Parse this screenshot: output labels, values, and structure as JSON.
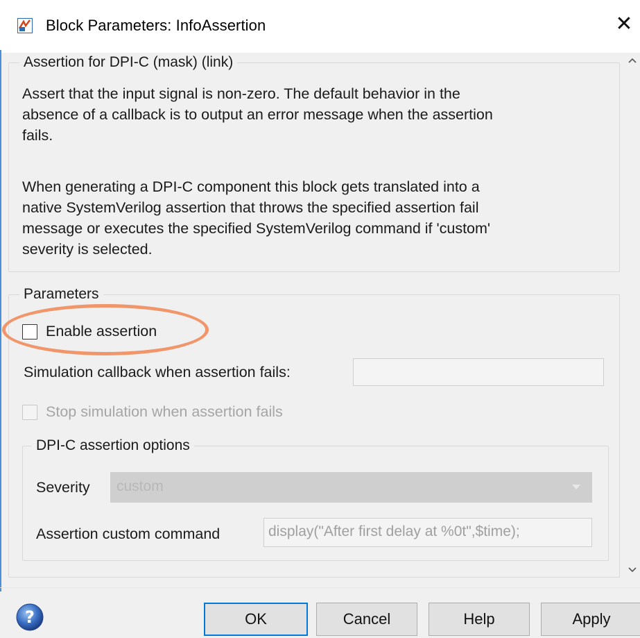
{
  "window": {
    "title": "Block Parameters: InfoAssertion",
    "close_glyph": "✕"
  },
  "description_group": {
    "legend": "Assertion for DPI-C (mask) (link)",
    "paragraph_1_lines": [
      "Assert that the input signal is non-zero. The default behavior in the",
      "absence of a callback is to output an error message when the assertion",
      "fails."
    ],
    "paragraph_2_lines": [
      "When generating a DPI-C component this block gets translated into a",
      "native SystemVerilog assertion that throws the specified assertion fail",
      "message or executes the specified SystemVerilog command if 'custom'",
      "severity is selected."
    ]
  },
  "parameters_group": {
    "legend": "Parameters",
    "enable_assertion": {
      "label": "Enable assertion",
      "checked": false
    },
    "sim_callback": {
      "label": "Simulation callback when assertion fails:",
      "value": ""
    },
    "stop_simulation": {
      "label": "Stop simulation when assertion fails",
      "checked": false,
      "disabled": true
    },
    "dpi_options": {
      "legend": "DPI-C assertion options",
      "severity_label": "Severity",
      "severity_value": "custom",
      "custom_command_label": "Assertion custom command",
      "custom_command_value": "display(\"After first delay at %0t\",$time);"
    }
  },
  "buttons": {
    "ok": "OK",
    "cancel": "Cancel",
    "help": "Help",
    "apply": "Apply"
  },
  "colors": {
    "highlight": "#f0966a",
    "default_button_border": "#0078d7"
  },
  "icons": {
    "app": "simulink-block-icon",
    "help": "help-question-icon",
    "scroll_up": "chevron-up-icon",
    "scroll_down": "chevron-down-icon"
  }
}
